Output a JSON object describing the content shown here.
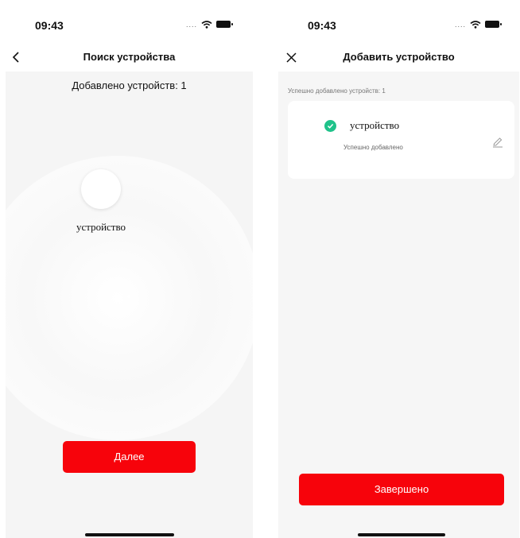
{
  "left_screen": {
    "status_bar": {
      "time": "09:43",
      "signal": "...."
    },
    "nav": {
      "title": "Поиск устройства",
      "back_icon": "chevron-left-icon"
    },
    "added_count": "Добавлено устройств: 1",
    "found_device": {
      "name": "устройство"
    },
    "next_button": "Далее"
  },
  "right_screen": {
    "status_bar": {
      "time": "09:43",
      "signal": "...."
    },
    "nav": {
      "title": "Добавить устройство",
      "close_icon": "close-icon"
    },
    "success_count": "Успешно добавлено устройств: 1",
    "device_card": {
      "name": "устройство",
      "status": "Успешно добавлено",
      "check_icon": "check-circle-icon",
      "edit_icon": "pencil-icon"
    },
    "done_button": "Завершено"
  },
  "colors": {
    "accent": "#f7030b",
    "success": "#1fc28a"
  }
}
